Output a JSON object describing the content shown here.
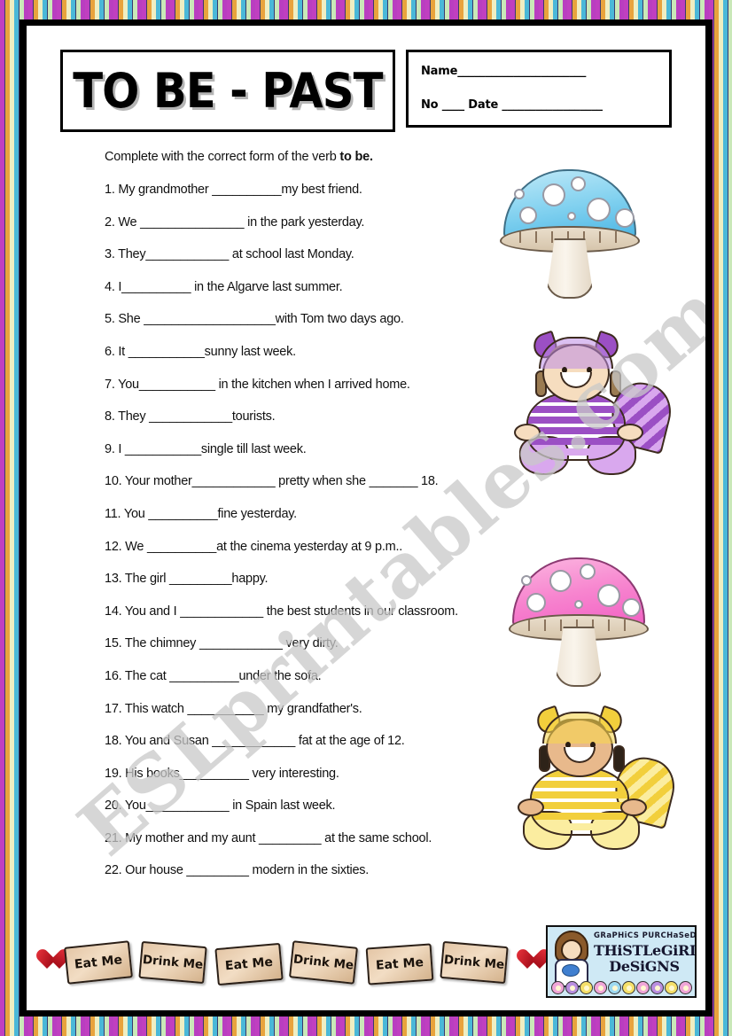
{
  "worksheet": {
    "title": "TO BE - PAST",
    "name_field_label": "Name",
    "name_field_line": "_______________________",
    "no_field_label": "No",
    "no_field_line": "____",
    "date_field_label": "Date",
    "date_field_line": "__________________",
    "instruction_prefix": "Complete with the correct form of the verb ",
    "instruction_bold": "to be.",
    "watermark": "ESLprintables.com"
  },
  "questions": [
    {
      "number": "1.",
      "text": "1. My grandmother __________my best friend."
    },
    {
      "number": "2.",
      "text": "2.  We _______________ in the park yesterday."
    },
    {
      "number": "3.",
      "text": "3. They____________ at school last Monday."
    },
    {
      "number": "4.",
      "text": "4. I__________ in the Algarve last summer."
    },
    {
      "number": "5.",
      "text": "5. She ___________________with Tom two days ago."
    },
    {
      "number": "6.",
      "text": "6. It ___________sunny last week."
    },
    {
      "number": "7.",
      "text": "7. You___________ in the kitchen when I arrived home."
    },
    {
      "number": "8.",
      "text": "8. They ____________tourists."
    },
    {
      "number": "9.",
      "text": "9. I ___________single till last week."
    },
    {
      "number": "10.",
      "text": "10. Your mother____________ pretty when she _______ 18."
    },
    {
      "number": "11.",
      "text": "11. You __________fine yesterday."
    },
    {
      "number": "12.",
      "text": "12. We __________at the cinema yesterday at 9 p.m.."
    },
    {
      "number": "13.",
      "text": "13. The girl _________happy."
    },
    {
      "number": "14.",
      "text": "14. You and I ____________ the best students in our classroom."
    },
    {
      "number": "15.",
      "text": "15. The chimney ____________ very dirty."
    },
    {
      "number": "16.",
      "text": "16. The cat __________under the sofa."
    },
    {
      "number": "17.",
      "text": "17. This watch ___________ my grandfather's."
    },
    {
      "number": "18.",
      "text": "18. You and Susan ____________ fat at the age of 12."
    },
    {
      "number": "19.",
      "text": "19. His  books__________ very interesting."
    },
    {
      "number": "20.",
      "text": "20. You____________ in Spain last week."
    },
    {
      "number": "21.",
      "text": "21. My mother and my aunt _________ at the same school."
    },
    {
      "number": "22.",
      "text": "22. Our house _________ modern in the sixties."
    }
  ],
  "clipart": [
    {
      "name": "blue-mushroom",
      "label": "blue mushroom with white spots"
    },
    {
      "name": "purple-cat-girl",
      "label": "girl in purple striped cat costume"
    },
    {
      "name": "pink-mushroom",
      "label": "pink mushroom with white spots"
    },
    {
      "name": "yellow-cat-girl",
      "label": "girl in yellow striped cat costume"
    }
  ],
  "footer": {
    "tags": [
      {
        "type": "heart",
        "label": ""
      },
      {
        "type": "tag",
        "label": "Eat Me"
      },
      {
        "type": "tag",
        "label": "Drink Me"
      },
      {
        "type": "tag",
        "label": "Eat Me"
      },
      {
        "type": "tag",
        "label": "Drink Me"
      },
      {
        "type": "tag",
        "label": "Eat Me"
      },
      {
        "type": "tag",
        "label": "Drink Me"
      },
      {
        "type": "heart",
        "label": ""
      }
    ],
    "credit_top": "GRaPHiCS PURCHaSeD aT",
    "credit_main": "THiSTLeGiRL DeSiGNS"
  },
  "colors": {
    "border_magenta": "#c03fc0",
    "border_orange": "#e8a33d",
    "border_cream": "#efeec2",
    "border_cyan": "#4ab8d8",
    "border_green": "#c9e8b8",
    "frame_black": "#000000",
    "mushroom_blue": "#7fd0ef",
    "mushroom_pink": "#f785cf",
    "costume_purple": "#9b4fc4",
    "costume_yellow": "#f2cf3c",
    "tag_tan": "#e4c6a6",
    "heart_red": "#d6222e",
    "credit_bg": "#cfe9f5",
    "watermark_gray": "#c9c9c9"
  }
}
